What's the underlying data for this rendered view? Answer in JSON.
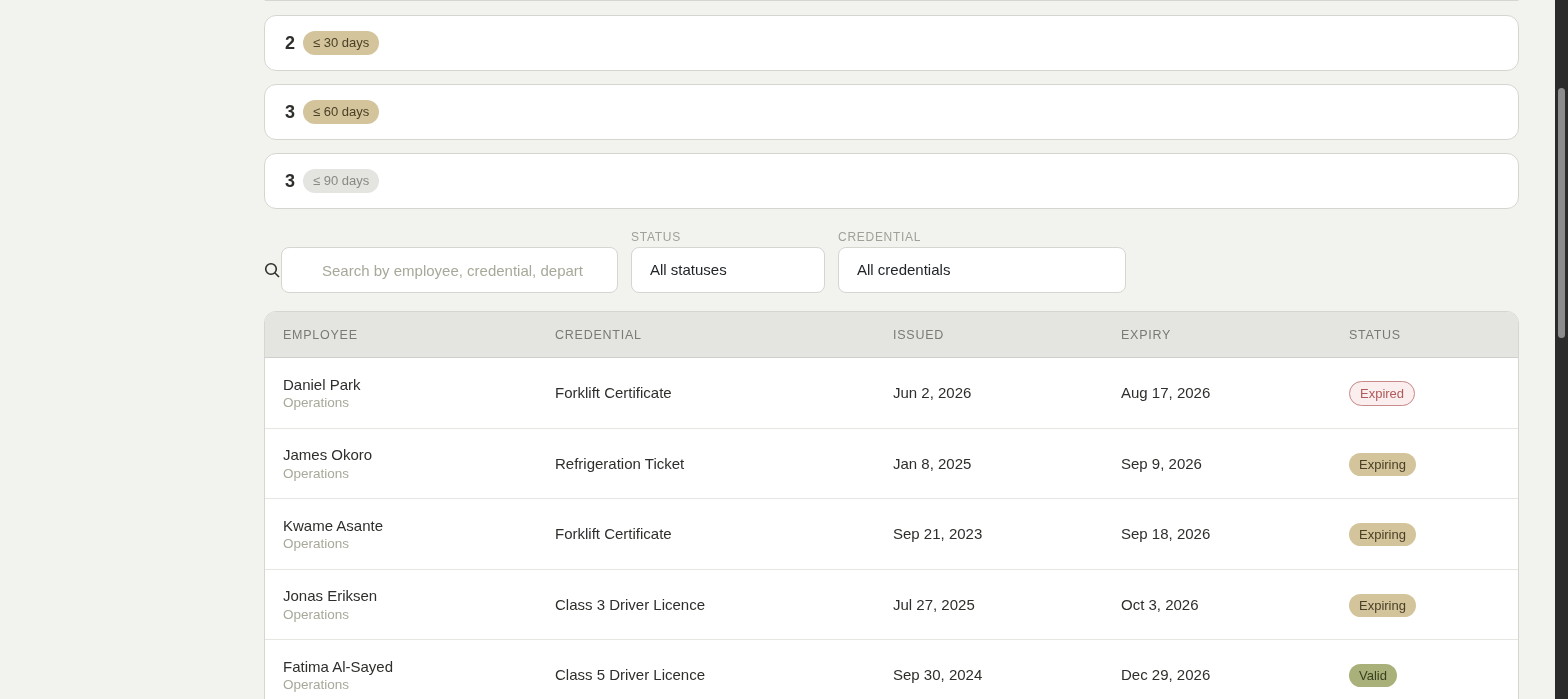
{
  "buckets": [
    {
      "count": "2",
      "label": "≤ 30 days",
      "kind": "tan"
    },
    {
      "count": "3",
      "label": "≤ 60 days",
      "kind": "tan"
    },
    {
      "count": "3",
      "label": "≤ 90 days",
      "kind": "grey"
    }
  ],
  "filters": {
    "search": {
      "placeholder": "Search by employee, credential, depart"
    },
    "status": {
      "label": "STATUS",
      "value": "All statuses"
    },
    "credential": {
      "label": "CREDENTIAL",
      "value": "All credentials"
    }
  },
  "table": {
    "columns": [
      "EMPLOYEE",
      "CREDENTIAL",
      "ISSUED",
      "EXPIRY",
      "STATUS"
    ],
    "rows": [
      {
        "employee": "Daniel Park",
        "department": "Operations",
        "credential": "Forklift Certificate",
        "issued": "Jun 2, 2026",
        "expiry": "Aug 17, 2026",
        "status": "Expired",
        "kind": "expired"
      },
      {
        "employee": "James Okoro",
        "department": "Operations",
        "credential": "Refrigeration Ticket",
        "issued": "Jan 8, 2025",
        "expiry": "Sep 9, 2026",
        "status": "Expiring",
        "kind": "expiring"
      },
      {
        "employee": "Kwame Asante",
        "department": "Operations",
        "credential": "Forklift Certificate",
        "issued": "Sep 21, 2023",
        "expiry": "Sep 18, 2026",
        "status": "Expiring",
        "kind": "expiring"
      },
      {
        "employee": "Jonas Eriksen",
        "department": "Operations",
        "credential": "Class 3 Driver Licence",
        "issued": "Jul 27, 2025",
        "expiry": "Oct 3, 2026",
        "status": "Expiring",
        "kind": "expiring"
      },
      {
        "employee": "Fatima Al-Sayed",
        "department": "Operations",
        "credential": "Class 5 Driver Licence",
        "issued": "Sep 30, 2024",
        "expiry": "Dec 29, 2026",
        "status": "Valid",
        "kind": "valid"
      }
    ]
  }
}
